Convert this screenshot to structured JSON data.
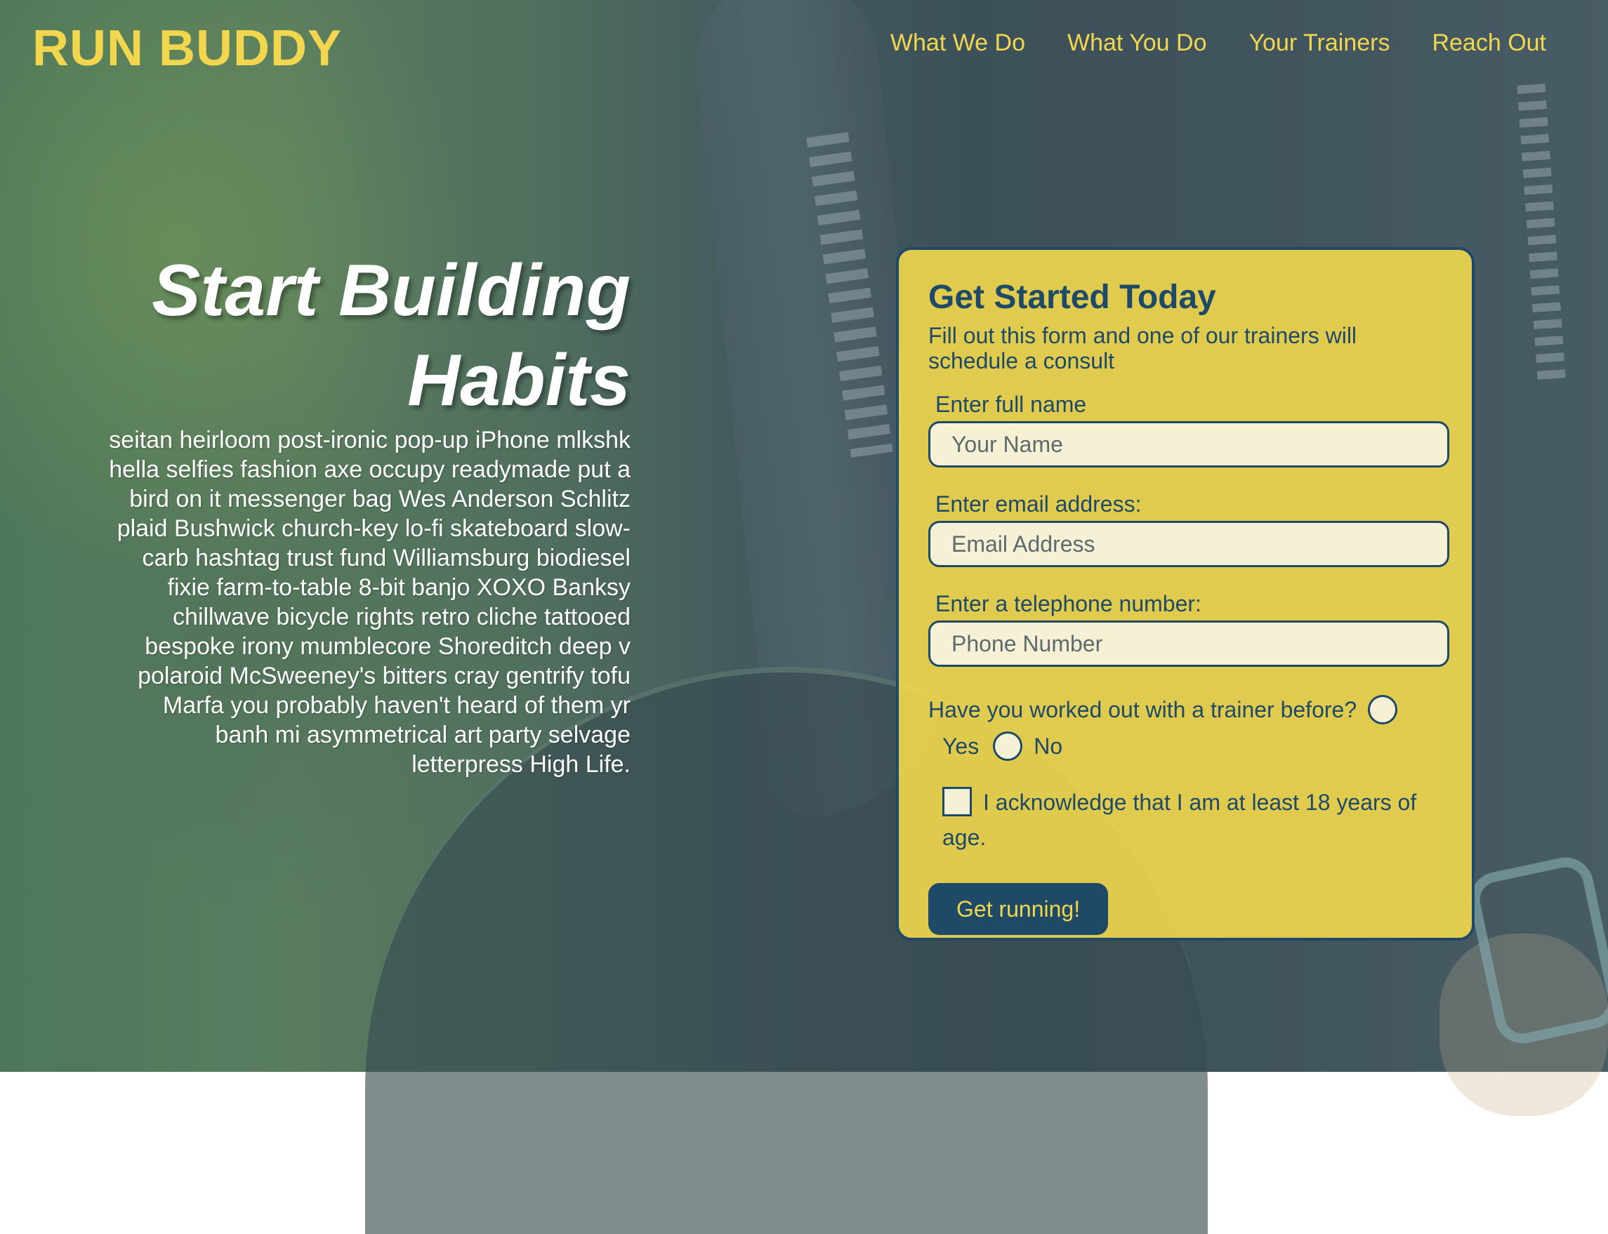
{
  "brand": {
    "name": "RUN BUDDY",
    "accent_color": "#f2d74e",
    "dark_color": "#1e4a68"
  },
  "nav": {
    "items": [
      {
        "label": "What We Do"
      },
      {
        "label": "What You Do"
      },
      {
        "label": "Your Trainers"
      },
      {
        "label": "Reach Out"
      }
    ]
  },
  "hero": {
    "title_line1": "Start Building",
    "title_line2": "Habits",
    "body": "seitan heirloom post-ironic pop-up iPhone mlkshk hella selfies fashion axe occupy readymade put a bird on it messenger bag Wes Anderson Schlitz plaid Bushwick church-key lo-fi skateboard slow-carb hashtag trust fund Williamsburg biodiesel fixie farm-to-table 8-bit banjo XOXO Banksy chillwave bicycle rights retro cliche tattooed bespoke irony mumblecore Shoreditch deep v polaroid McSweeney's bitters cray gentrify tofu Marfa you probably haven't heard of them yr banh mi asymmetrical art party selvage letterpress High Life."
  },
  "form": {
    "title": "Get Started Today",
    "intro": "Fill out this form and one of our trainers will schedule a consult",
    "name": {
      "label": "Enter full name",
      "placeholder": "Your Name",
      "value": ""
    },
    "email": {
      "label": "Enter email address:",
      "placeholder": "Email Address",
      "value": ""
    },
    "phone": {
      "label": "Enter a telephone number:",
      "placeholder": "Phone Number",
      "value": ""
    },
    "trainer_question": "Have you worked out with a trainer before?",
    "option_yes": "Yes",
    "option_no": "No",
    "acknowledge": "I acknowledge that I am at least 18 years of age.",
    "submit_label": "Get running!"
  }
}
